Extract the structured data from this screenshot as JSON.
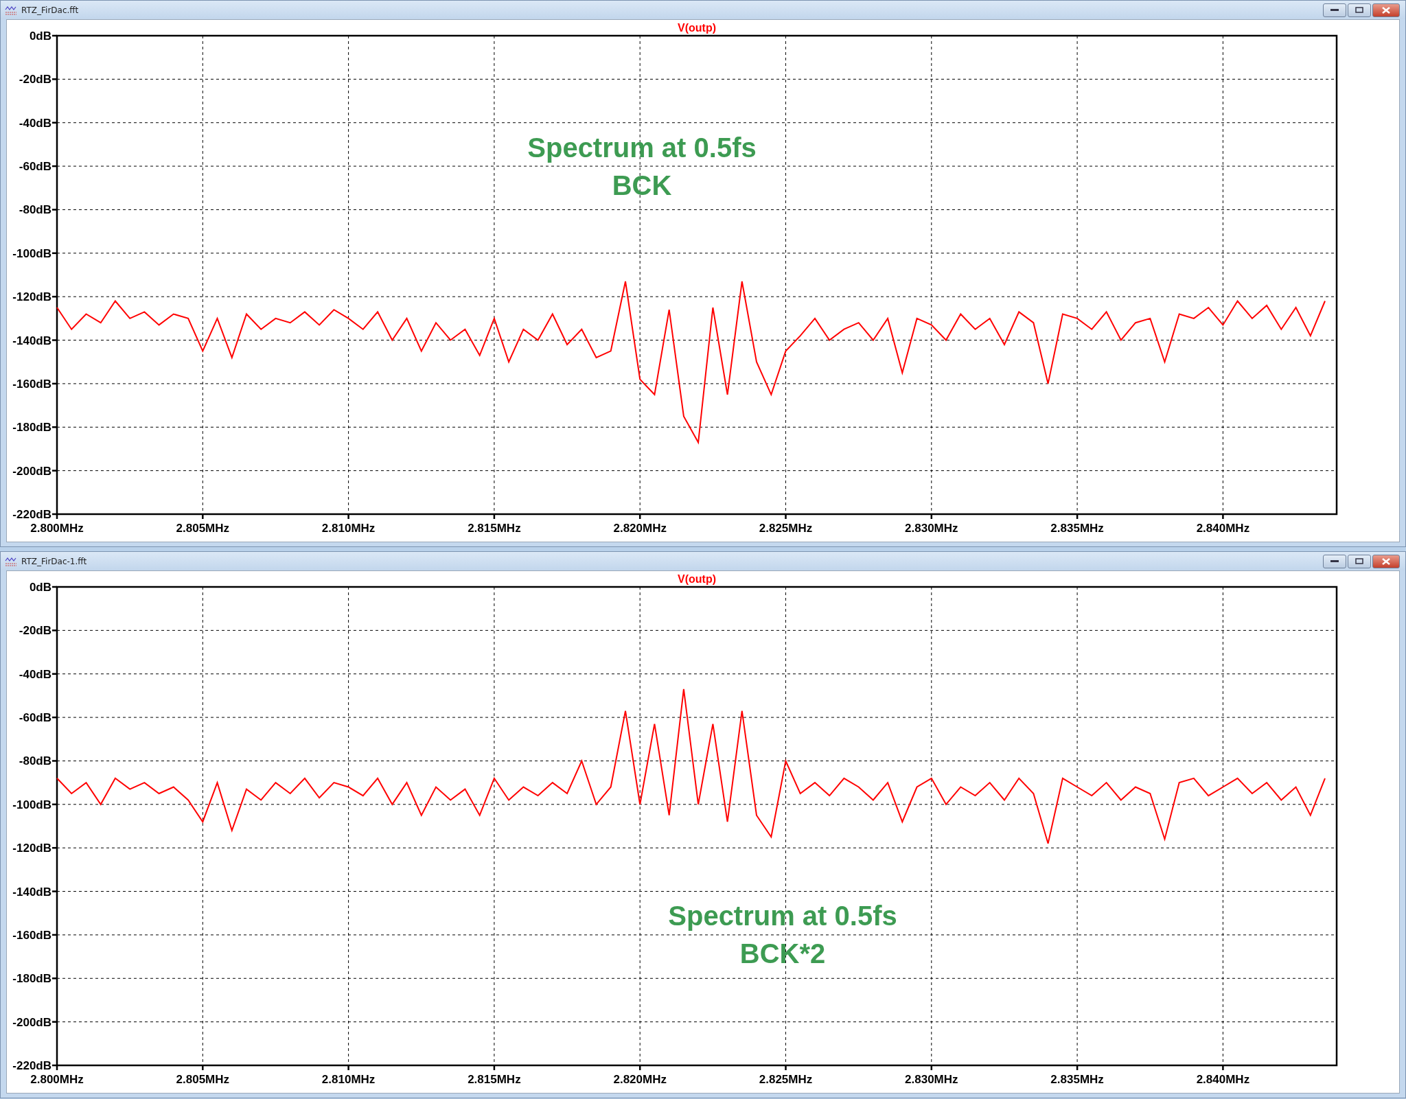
{
  "windows": [
    {
      "title": "RTZ_FirDac.fft",
      "plot": {
        "chart_data": {
          "type": "line",
          "grid": true,
          "xlim": [
            2.8,
            2.8439
          ],
          "ylim": [
            -220,
            0
          ],
          "xticks": [
            {
              "value": 2.8,
              "label": "2.800MHz"
            },
            {
              "value": 2.805,
              "label": "2.805MHz"
            },
            {
              "value": 2.81,
              "label": "2.810MHz"
            },
            {
              "value": 2.815,
              "label": "2.815MHz"
            },
            {
              "value": 2.82,
              "label": "2.820MHz"
            },
            {
              "value": 2.825,
              "label": "2.825MHz"
            },
            {
              "value": 2.83,
              "label": "2.830MHz"
            },
            {
              "value": 2.835,
              "label": "2.835MHz"
            },
            {
              "value": 2.84,
              "label": "2.840MHz"
            }
          ],
          "yticks": [
            {
              "value": 0,
              "label": "0dB"
            },
            {
              "value": -20,
              "label": "-20dB"
            },
            {
              "value": -40,
              "label": "-40dB"
            },
            {
              "value": -60,
              "label": "-60dB"
            },
            {
              "value": -80,
              "label": "-80dB"
            },
            {
              "value": -100,
              "label": "-100dB"
            },
            {
              "value": -120,
              "label": "-120dB"
            },
            {
              "value": -140,
              "label": "-140dB"
            },
            {
              "value": -160,
              "label": "-160dB"
            },
            {
              "value": -180,
              "label": "-180dB"
            },
            {
              "value": -200,
              "label": "-200dB"
            },
            {
              "value": -220,
              "label": "-220dB"
            }
          ],
          "x": [
            2.8,
            2.8005,
            2.801,
            2.8015,
            2.802,
            2.8025,
            2.803,
            2.8035,
            2.804,
            2.8045,
            2.805,
            2.8055,
            2.806,
            2.8065,
            2.807,
            2.8075,
            2.808,
            2.8085,
            2.809,
            2.8095,
            2.81,
            2.8105,
            2.811,
            2.8115,
            2.812,
            2.8125,
            2.813,
            2.8135,
            2.814,
            2.8145,
            2.815,
            2.8155,
            2.816,
            2.8165,
            2.817,
            2.8175,
            2.818,
            2.8185,
            2.819,
            2.8195,
            2.82,
            2.8205,
            2.821,
            2.8215,
            2.822,
            2.8225,
            2.823,
            2.8235,
            2.824,
            2.8245,
            2.825,
            2.8255,
            2.826,
            2.8265,
            2.827,
            2.8275,
            2.828,
            2.8285,
            2.829,
            2.8295,
            2.83,
            2.8305,
            2.831,
            2.8315,
            2.832,
            2.8325,
            2.833,
            2.8335,
            2.834,
            2.8345,
            2.835,
            2.8355,
            2.836,
            2.8365,
            2.837,
            2.8375,
            2.838,
            2.8385,
            2.839,
            2.8395,
            2.84,
            2.8405,
            2.841,
            2.8415,
            2.842,
            2.8425,
            2.843,
            2.8435
          ],
          "series": [
            {
              "name": "V(outp)",
              "color": "#ff0000",
              "values": [
                -125,
                -135,
                -128,
                -132,
                -122,
                -130,
                -127,
                -133,
                -128,
                -130,
                -145,
                -130,
                -148,
                -128,
                -135,
                -130,
                -132,
                -127,
                -133,
                -126,
                -130,
                -135,
                -127,
                -140,
                -130,
                -145,
                -132,
                -140,
                -135,
                -147,
                -130,
                -150,
                -135,
                -140,
                -128,
                -142,
                -135,
                -148,
                -145,
                -113,
                -158,
                -165,
                -126,
                -175,
                -187,
                -125,
                -165,
                -113,
                -150,
                -165,
                -145,
                -138,
                -130,
                -140,
                -135,
                -132,
                -140,
                -130,
                -155,
                -130,
                -133,
                -140,
                -128,
                -135,
                -130,
                -142,
                -127,
                -132,
                -160,
                -128,
                -130,
                -135,
                -127,
                -140,
                -132,
                -130,
                -150,
                -128,
                -130,
                -125,
                -133,
                -122,
                -130,
                -124,
                -135,
                -125,
                -138,
                -122
              ]
            }
          ],
          "annotations": [
            "Spectrum at 0.5fs",
            "BCK"
          ]
        }
      }
    },
    {
      "title": "RTZ_FirDac-1.fft",
      "plot": {
        "chart_data": {
          "type": "line",
          "grid": true,
          "xlim": [
            2.8,
            2.8439
          ],
          "ylim": [
            -220,
            0
          ],
          "xticks": [
            {
              "value": 2.8,
              "label": "2.800MHz"
            },
            {
              "value": 2.805,
              "label": "2.805MHz"
            },
            {
              "value": 2.81,
              "label": "2.810MHz"
            },
            {
              "value": 2.815,
              "label": "2.815MHz"
            },
            {
              "value": 2.82,
              "label": "2.820MHz"
            },
            {
              "value": 2.825,
              "label": "2.825MHz"
            },
            {
              "value": 2.83,
              "label": "2.830MHz"
            },
            {
              "value": 2.835,
              "label": "2.835MHz"
            },
            {
              "value": 2.84,
              "label": "2.840MHz"
            }
          ],
          "yticks": [
            {
              "value": 0,
              "label": "0dB"
            },
            {
              "value": -20,
              "label": "-20dB"
            },
            {
              "value": -40,
              "label": "-40dB"
            },
            {
              "value": -60,
              "label": "-60dB"
            },
            {
              "value": -80,
              "label": "-80dB"
            },
            {
              "value": -100,
              "label": "-100dB"
            },
            {
              "value": -120,
              "label": "-120dB"
            },
            {
              "value": -140,
              "label": "-140dB"
            },
            {
              "value": -160,
              "label": "-160dB"
            },
            {
              "value": -180,
              "label": "-180dB"
            },
            {
              "value": -200,
              "label": "-200dB"
            },
            {
              "value": -220,
              "label": "-220dB"
            }
          ],
          "x": [
            2.8,
            2.8005,
            2.801,
            2.8015,
            2.802,
            2.8025,
            2.803,
            2.8035,
            2.804,
            2.8045,
            2.805,
            2.8055,
            2.806,
            2.8065,
            2.807,
            2.8075,
            2.808,
            2.8085,
            2.809,
            2.8095,
            2.81,
            2.8105,
            2.811,
            2.8115,
            2.812,
            2.8125,
            2.813,
            2.8135,
            2.814,
            2.8145,
            2.815,
            2.8155,
            2.816,
            2.8165,
            2.817,
            2.8175,
            2.818,
            2.8185,
            2.819,
            2.8195,
            2.82,
            2.8205,
            2.821,
            2.8215,
            2.822,
            2.8225,
            2.823,
            2.8235,
            2.824,
            2.8245,
            2.825,
            2.8255,
            2.826,
            2.8265,
            2.827,
            2.8275,
            2.828,
            2.8285,
            2.829,
            2.8295,
            2.83,
            2.8305,
            2.831,
            2.8315,
            2.832,
            2.8325,
            2.833,
            2.8335,
            2.834,
            2.8345,
            2.835,
            2.8355,
            2.836,
            2.8365,
            2.837,
            2.8375,
            2.838,
            2.8385,
            2.839,
            2.8395,
            2.84,
            2.8405,
            2.841,
            2.8415,
            2.842,
            2.8425,
            2.843,
            2.8435
          ],
          "series": [
            {
              "name": "V(outp)",
              "color": "#ff0000",
              "values": [
                -88,
                -95,
                -90,
                -100,
                -88,
                -93,
                -90,
                -95,
                -92,
                -98,
                -108,
                -90,
                -112,
                -93,
                -98,
                -90,
                -95,
                -88,
                -97,
                -90,
                -92,
                -96,
                -88,
                -100,
                -90,
                -105,
                -92,
                -98,
                -93,
                -105,
                -88,
                -98,
                -92,
                -96,
                -90,
                -95,
                -80,
                -100,
                -92,
                -57,
                -100,
                -63,
                -105,
                -47,
                -100,
                -63,
                -108,
                -57,
                -105,
                -115,
                -80,
                -95,
                -90,
                -96,
                -88,
                -92,
                -98,
                -90,
                -108,
                -92,
                -88,
                -100,
                -92,
                -96,
                -90,
                -98,
                -88,
                -95,
                -118,
                -88,
                -92,
                -96,
                -90,
                -98,
                -92,
                -95,
                -116,
                -90,
                -88,
                -96,
                -92,
                -88,
                -95,
                -90,
                -98,
                -92,
                -105,
                -88
              ]
            }
          ],
          "annotations": [
            "Spectrum at 0.5fs",
            "BCK*2"
          ]
        }
      }
    }
  ]
}
